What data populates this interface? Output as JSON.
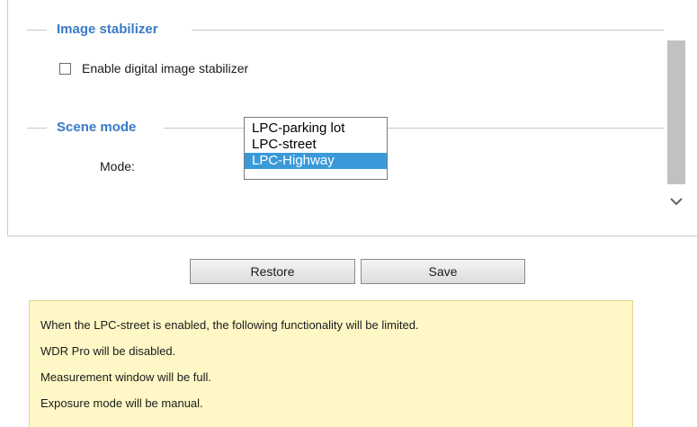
{
  "image_stabilizer": {
    "title": "Image stabilizer",
    "checkbox_label": "Enable digital image stabilizer",
    "checked": false
  },
  "scene_mode": {
    "title": "Scene mode",
    "mode_label": "Mode:",
    "options": [
      "LPC-parking lot",
      "LPC-street",
      "LPC-Highway"
    ],
    "selected": "LPC-Highway"
  },
  "buttons": {
    "restore": "Restore",
    "save": "Save"
  },
  "notice": {
    "lines": [
      "When the LPC-street is enabled, the following functionality will be limited.",
      "WDR Pro will be disabled.",
      "Measurement window will be full.",
      "Exposure mode will be manual."
    ]
  },
  "icons": {
    "scroll_down": "chevron-down-icon"
  },
  "colors": {
    "legend_title": "#3a7ac4",
    "selected_option_bg": "#3a9ad9",
    "notice_bg": "#fff8c6",
    "notice_border": "#e4d48a"
  }
}
